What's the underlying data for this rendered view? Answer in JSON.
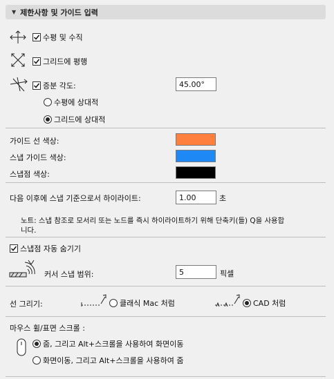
{
  "header": {
    "title": "제한사항 및 가이드 입력"
  },
  "constraints": {
    "horiz_vert_label": "수평 및 수직",
    "grid_parallel_label": "그리드에 평행",
    "increment_angle_label": "증분 각도:",
    "increment_angle_value": "45.00°",
    "relative_horizontal_label": "수평에 상대적",
    "relative_grid_label": "그리드에 상대적"
  },
  "colors": {
    "guide_line_label": "가이드 선 색상:",
    "guide_line_color": "#ff7f3f",
    "snap_guide_label": "스냅 가이드 색상:",
    "snap_guide_color": "#1e88f5",
    "snap_point_label": "스냅점 색상:",
    "snap_point_color": "#000000"
  },
  "highlight": {
    "label": "다음 이후에 스냅 기준으로서 하이라이트:",
    "value": "1.00",
    "unit": "초",
    "note_line1": "노트: 스냅 참조로 모서리 또는 노드를 즉시 하이라이트하기 위해 단축키(들) Q을 사용합",
    "note_line2": "니다."
  },
  "snap": {
    "hide_snap_points_label": "스냅점 자동 숨기기",
    "cursor_range_label": "커서 스냅 범위:",
    "cursor_range_value": "5",
    "cursor_range_unit": "픽셀"
  },
  "line_drawing": {
    "label": "선 그리기:",
    "classic_mac_label": "클래식 Mac 처럼",
    "cad_label": "CAD 처럼"
  },
  "mouse_wheel": {
    "label": "마우스 휠/표면 스크롤 :",
    "option1_label": "줌, 그리고 Alt+스크롤을 사용하여 화면이동",
    "option2_label": "화면이동, 그리고 Alt+스크롤을 사용하여 줌"
  }
}
